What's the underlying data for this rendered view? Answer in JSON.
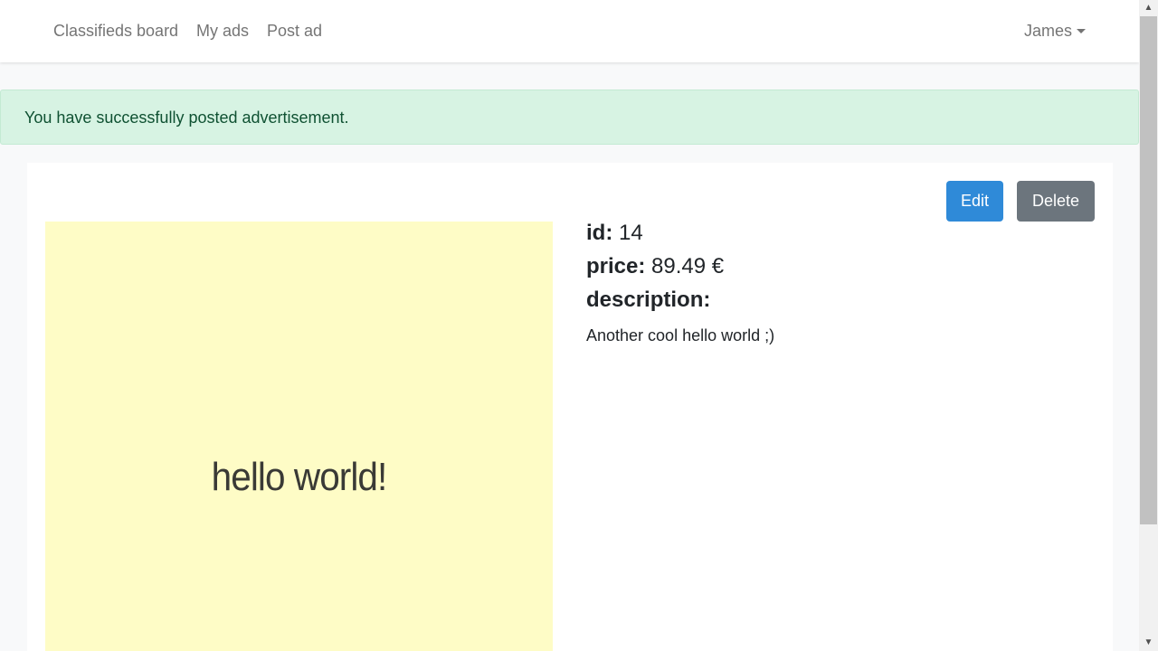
{
  "navbar": {
    "brand": "Classifieds board",
    "links": [
      "My ads",
      "Post ad"
    ],
    "user": "James"
  },
  "alert": {
    "message": "You have successfully posted advertisement."
  },
  "ad": {
    "buttons": {
      "edit": "Edit",
      "delete": "Delete"
    },
    "image_text": "hello world!",
    "fields": {
      "id_label": "id:",
      "id_value": "14",
      "price_label": "price:",
      "price_value": "89.49 €",
      "description_label": "description:",
      "description_value": "Another cool hello world ;)"
    }
  },
  "scrollbar": {
    "up_arrow": "▲",
    "down_arrow": "▼"
  }
}
